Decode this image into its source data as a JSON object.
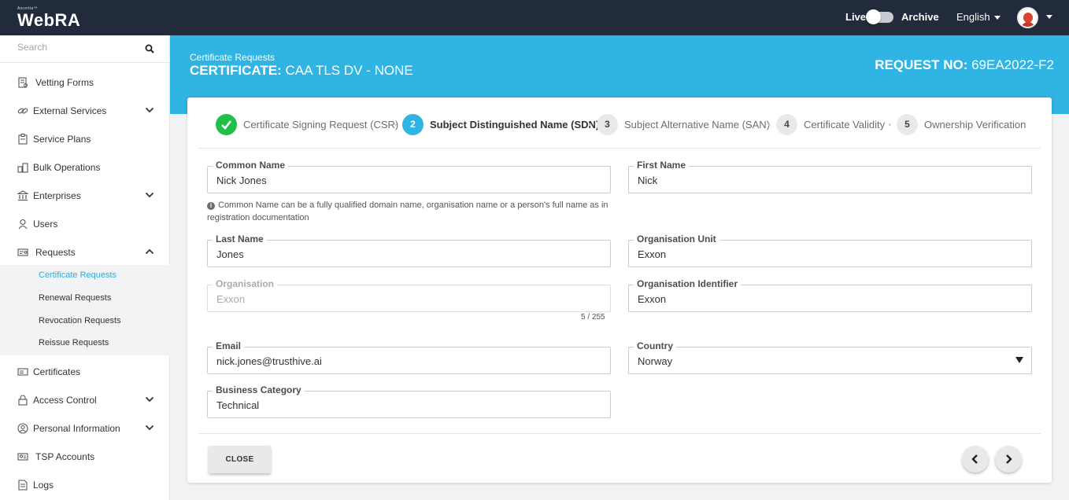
{
  "topbar": {
    "brand_small": "Ascertia™",
    "brand_name": "WebRA",
    "live_label": "Live",
    "archive_label": "Archive",
    "language": "English"
  },
  "sidebar": {
    "search_placeholder": "Search",
    "items": [
      {
        "label": "Vetting Forms"
      },
      {
        "label": "External Services"
      },
      {
        "label": "Service Plans"
      },
      {
        "label": "Bulk Operations"
      },
      {
        "label": "Enterprises"
      },
      {
        "label": "Users"
      },
      {
        "label": "Requests"
      },
      {
        "label": "Certificates"
      },
      {
        "label": "Access Control"
      },
      {
        "label": "Personal Information"
      },
      {
        "label": "TSP Accounts"
      },
      {
        "label": "Logs"
      }
    ],
    "sub_items": [
      {
        "label": "Certificate Requests",
        "active": true
      },
      {
        "label": "Renewal Requests"
      },
      {
        "label": "Revocation Requests"
      },
      {
        "label": "Reissue Requests"
      }
    ]
  },
  "banner": {
    "breadcrumb": "Certificate Requests",
    "certificate_prefix": "CERTIFICATE:",
    "certificate_value": "CAA TLS DV - NONE",
    "request_prefix": "REQUEST NO:",
    "request_value": "69EA2022-F2"
  },
  "stepper": {
    "steps": [
      {
        "number": "",
        "label": "Certificate Signing Request (CSR)",
        "status": "done"
      },
      {
        "number": "2",
        "label": "Subject Distinguished Name (SDN)",
        "status": "current"
      },
      {
        "number": "3",
        "label": "Subject Alternative Name (SAN)",
        "status": "pending"
      },
      {
        "number": "4",
        "label": "Certificate Validity",
        "status": "pending"
      },
      {
        "number": "5",
        "label": "Ownership Verification",
        "status": "pending"
      }
    ]
  },
  "form": {
    "common_name": {
      "label": "Common Name",
      "value": "Nick Jones"
    },
    "common_name_hint": "Common Name can be a fully qualified domain name, organisation name or a person's full name as in registration documentation",
    "first_name": {
      "label": "First Name",
      "value": "Nick"
    },
    "last_name": {
      "label": "Last Name",
      "value": "Jones"
    },
    "organisation_unit": {
      "label": "Organisation Unit",
      "value": "Exxon"
    },
    "organisation": {
      "label": "Organisation",
      "value": "Exxon",
      "counter": "5 / 255"
    },
    "organisation_identifier": {
      "label": "Organisation Identifier",
      "value": "Exxon"
    },
    "email": {
      "label": "Email",
      "value": "nick.jones@trusthive.ai"
    },
    "country": {
      "label": "Country",
      "value": "Norway"
    },
    "business_category": {
      "label": "Business Category",
      "value": "Technical"
    }
  },
  "actions": {
    "close_label": "CLOSE"
  },
  "colors": {
    "topbar": "#222b3b",
    "accent": "#30b4e4",
    "success": "#1fbf48"
  }
}
